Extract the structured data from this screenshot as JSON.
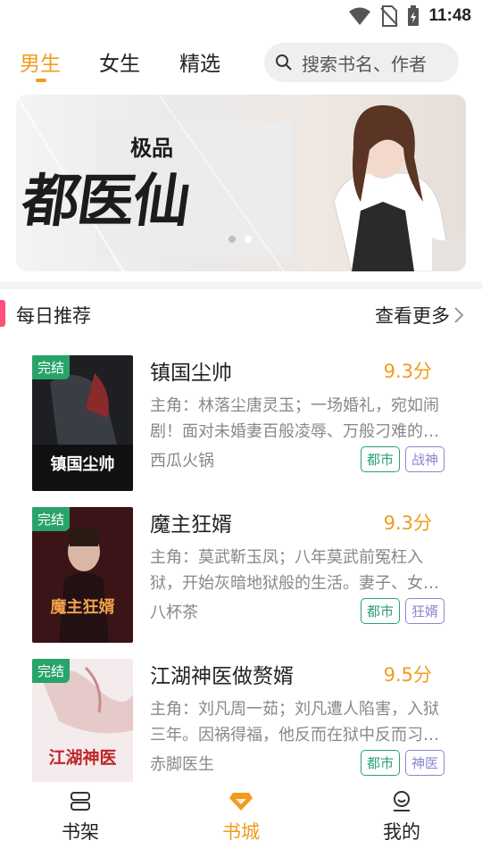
{
  "status": {
    "time": "11:48"
  },
  "top_tabs": [
    {
      "label": "男生",
      "active": true
    },
    {
      "label": "女生",
      "active": false
    },
    {
      "label": "精选",
      "active": false
    }
  ],
  "search": {
    "placeholder": "搜索书名、作者"
  },
  "banner": {
    "title": "都医仙",
    "subtitle": "极品",
    "dots_total": 2,
    "dot_active": 2
  },
  "section": {
    "title": "每日推荐",
    "more_label": "查看更多"
  },
  "books": [
    {
      "badge": "完结",
      "title": "镇国尘帅",
      "score": "9.3分",
      "desc": "主角：林落尘唐灵玉；一场婚礼，宛如闹剧！面对未婚妻百般凌辱、万般刁难的退…",
      "author": "西瓜火锅",
      "tags": [
        "都市",
        "战神"
      ],
      "cover_text": "镇国尘帅"
    },
    {
      "badge": "完结",
      "title": "魔主狂婿",
      "score": "9.3分",
      "desc": "主角：莫武靳玉凤；八年莫武前冤枉入狱，开始灰暗地狱般的生活。妻子、女儿…",
      "author": "八杯茶",
      "tags": [
        "都市",
        "狂婿"
      ],
      "cover_text": "魔主狂婿"
    },
    {
      "badge": "完结",
      "title": "江湖神医做赘婿",
      "score": "9.5分",
      "desc": "主角：刘凡周一茹；刘凡遭人陷害，入狱三年。因祸得福，他反而在狱中反而习得…",
      "author": "赤脚医生",
      "tags": [
        "都市",
        "神医"
      ],
      "cover_text": "江湖神医"
    }
  ],
  "bottom_nav": [
    {
      "label": "书架",
      "icon": "bookshelf-icon",
      "active": false
    },
    {
      "label": "书城",
      "icon": "diamond-icon",
      "active": true
    },
    {
      "label": "我的",
      "icon": "profile-icon",
      "active": false
    }
  ],
  "colors": {
    "accent": "#f29b1e",
    "badge_green": "#28a36a",
    "tag_green": "#2b9f77",
    "tag_purple": "#8a86cf",
    "section_accent": "#ff4f7b"
  }
}
